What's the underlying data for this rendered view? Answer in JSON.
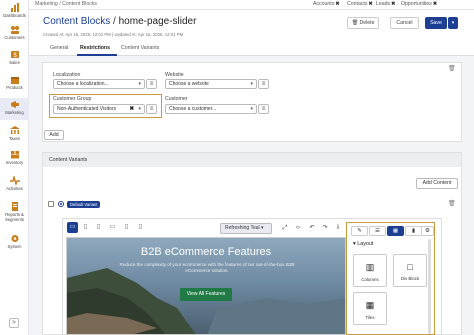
{
  "sidebar": {
    "items": [
      {
        "label": "Dashboards",
        "icon": "bar-chart-icon"
      },
      {
        "label": "Customers",
        "icon": "people-icon"
      },
      {
        "label": "Sales",
        "icon": "money-icon"
      },
      {
        "label": "Products",
        "icon": "box-icon"
      },
      {
        "label": "Marketing",
        "icon": "megaphone-icon"
      },
      {
        "label": "Taxes",
        "icon": "bank-icon"
      },
      {
        "label": "Inventory",
        "icon": "inventory-icon"
      },
      {
        "label": "Activities",
        "icon": "activity-icon"
      },
      {
        "label": "Reports & Segments",
        "icon": "reports-icon"
      },
      {
        "label": "System",
        "icon": "gear-icon"
      }
    ],
    "collapse_glyph": ">"
  },
  "topbar": {
    "breadcrumb": "Marketing / Content Blocks",
    "tabs": [
      {
        "label": "Accounts",
        "close": "✖"
      },
      {
        "label": "Contacts",
        "close": "✖"
      },
      {
        "label": "Leads",
        "close": "✖"
      },
      {
        "label": "Opportunities",
        "close": "✖"
      }
    ]
  },
  "header": {
    "title": "Content Blocks",
    "separator": "/",
    "name": "home-page-slider",
    "created": "Created At: Apr 16, 2025, 12:01 PM",
    "updated": "Updated At: Apr 16, 2025, 12:01 PM",
    "delete_label": "Delete",
    "cancel_label": "Cancel",
    "save_label": "Save"
  },
  "tabs": [
    "General",
    "Restrictions",
    "Content Variants"
  ],
  "restrictions": {
    "localization_label": "Localization",
    "localization_placeholder": "Choose a localization...",
    "website_label": "Website",
    "website_placeholder": "Choose a website",
    "customer_group_label": "Customer Group",
    "customer_group_value": "Non-Authenticated Visitors",
    "customer_label": "Customer",
    "customer_placeholder": "Choose a customer...",
    "add_label": "Add"
  },
  "content_variants": {
    "title": "Content Variants",
    "add_content_label": "Add Content",
    "default_badge": "Default Variant"
  },
  "editor": {
    "refresh_label": "Refreshing Teal",
    "hero_title": "B2B eCommerce Features",
    "hero_text": "Reduce the complexity of your ecommerce with the features of our out-of-the-box B2B eCommerce solution.",
    "hero_button": "View All Features"
  },
  "panel": {
    "layout_heading": "Layout",
    "blocks": [
      "Columns",
      "Div Block",
      "Tiles"
    ]
  }
}
